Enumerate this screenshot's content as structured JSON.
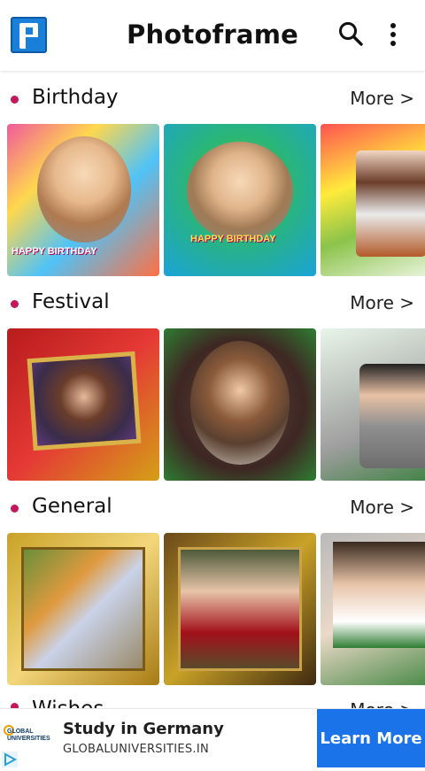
{
  "app": {
    "title": "Photoframe",
    "logo_icon": "photoframe-logo-icon",
    "search_icon": "search-icon",
    "menu_icon": "more-vert-icon"
  },
  "sections": [
    {
      "title": "Birthday",
      "more_label": "More >",
      "thumbnails": [
        {
          "overlay_text": "HAPPY BIRTHDAY"
        },
        {
          "overlay_text": "HAPPY BIRTHDAY"
        },
        {
          "overlay_text": ""
        }
      ]
    },
    {
      "title": "Festival",
      "more_label": "More >",
      "thumbnails": [
        {
          "overlay_text": ""
        },
        {
          "overlay_text": ""
        },
        {
          "overlay_text": ""
        }
      ]
    },
    {
      "title": "General",
      "more_label": "More >",
      "thumbnails": [
        {
          "overlay_text": ""
        },
        {
          "overlay_text": ""
        },
        {
          "overlay_text": ""
        }
      ]
    },
    {
      "title": "Wishes",
      "more_label": "More >"
    }
  ],
  "ad": {
    "logo_text": "GLOBAL UNIVERSITIES",
    "headline": "Study in Germany",
    "url": "GLOBALUNIVERSITIES.IN",
    "cta_label": "Learn More"
  },
  "colors": {
    "accent_dot": "#c2185b",
    "cta_blue": "#1a73e8",
    "logo_blue": "#1a7fd8"
  }
}
